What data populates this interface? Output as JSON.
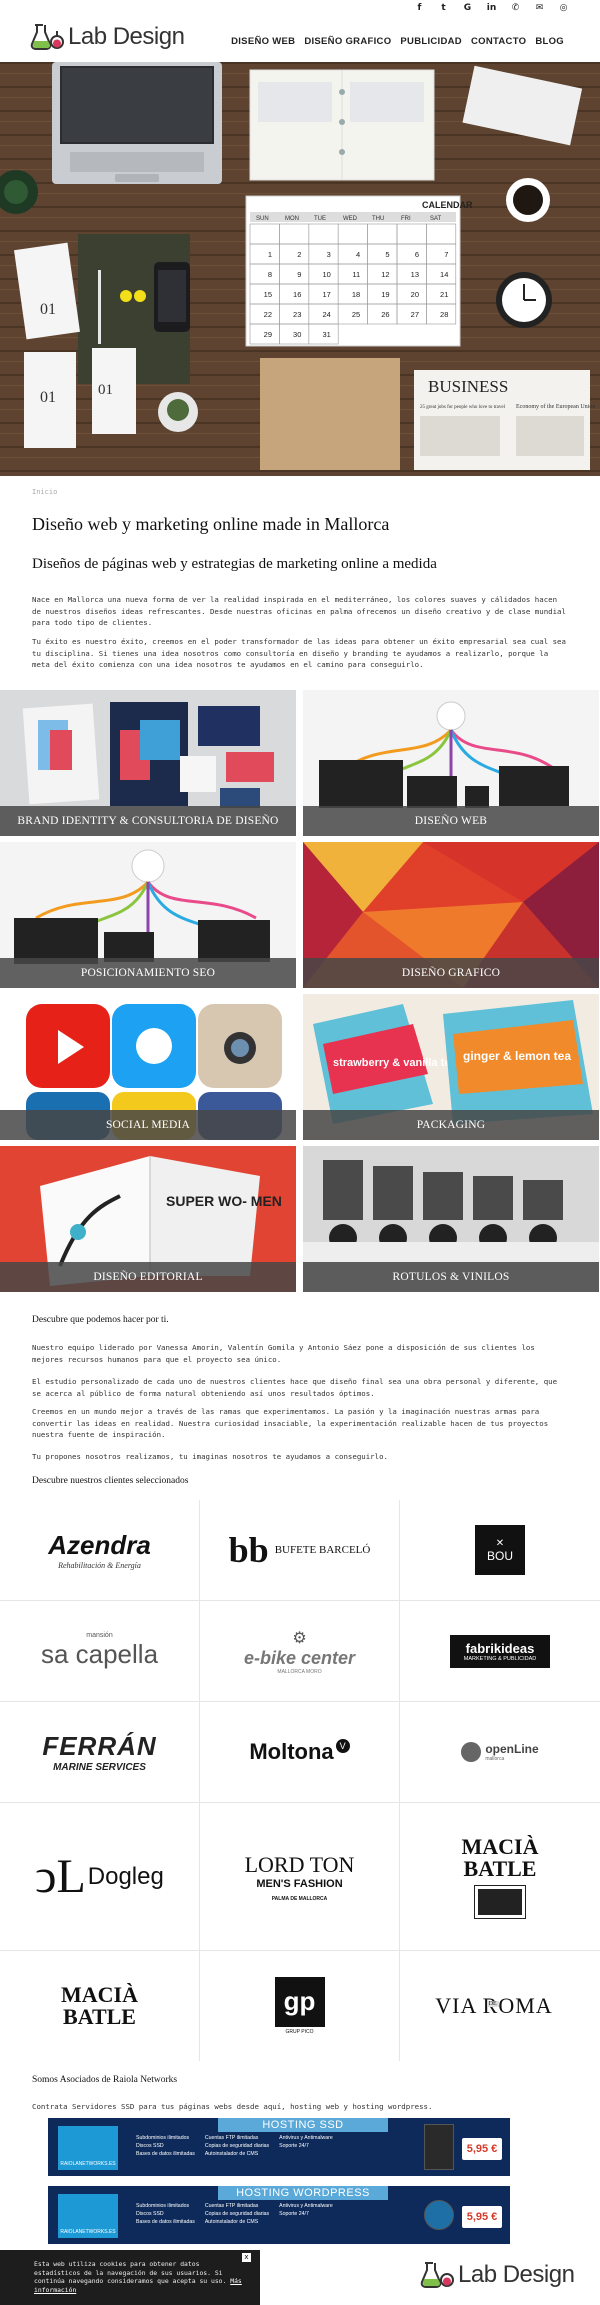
{
  "brand": {
    "name": "Lab Design"
  },
  "social": [
    {
      "icon": "facebook-icon",
      "glyph": "f"
    },
    {
      "icon": "twitter-icon",
      "glyph": "t"
    },
    {
      "icon": "google-icon",
      "glyph": "G"
    },
    {
      "icon": "linkedin-icon",
      "glyph": "in"
    },
    {
      "icon": "phone-icon",
      "glyph": "✆"
    },
    {
      "icon": "email-icon",
      "glyph": "✉"
    },
    {
      "icon": "instagram-icon",
      "glyph": "◎"
    }
  ],
  "nav": [
    "DISEÑO WEB",
    "DISEÑO GRAFICO",
    "PUBLICIDAD",
    "CONTACTO",
    "BLOG"
  ],
  "hero": {
    "calendar_title": "CALENDAR",
    "weekdays": [
      "SUN",
      "MON",
      "TUE",
      "WED",
      "THU",
      "FRI",
      "SAT"
    ],
    "days": [
      "",
      "",
      "",
      "",
      "",
      "",
      "",
      "1",
      "2",
      "3",
      "4",
      "5",
      "6",
      "7",
      "8",
      "9",
      "10",
      "11",
      "12",
      "13",
      "14",
      "15",
      "16",
      "17",
      "18",
      "19",
      "20",
      "21",
      "22",
      "23",
      "24",
      "25",
      "26",
      "27",
      "28",
      "29",
      "30",
      "31"
    ],
    "newspaper_title": "BUSINESS",
    "newspaper_headline1": "25 great jobs for people who love to travel",
    "newspaper_headline2": "Economy of the European Union",
    "notebook_nums": [
      "01",
      "01",
      "01"
    ]
  },
  "breadcrumb": "Inicio",
  "title": "Diseño web y marketing online made in Mallorca",
  "subtitle": "Diseños de páginas web y estrategias de marketing online a medida",
  "intro": [
    "Nace en Mallorca una nueva forma de ver la realidad inspirada en el mediterráneo, los colores suaves y cálidados hacen de nuestros diseños ideas refrescantes. Desde nuestras oficinas en palma ofrecemos un diseño creativo y de clase mundial para todo tipo de clientes.",
    "Tu éxito es nuestro éxito, creemos en el poder transformador de las ideas para obtener un éxito empresarial sea cual sea tu disciplina. Si tienes una idea nosotros como consultoría en diseño y branding te ayudamos a realizarlo, porque la meta del éxito comienza con una idea nosotros te ayudamos en el camino para conseguirlo."
  ],
  "services": [
    "BRAND IDENTITY & CONSULTORIA DE DISEÑO",
    "DISEÑO WEB",
    "POSICIONAMIENTO SEO",
    "DISEÑO GRAFICO",
    "SOCIAL MEDIA",
    "PACKAGING",
    "DISEÑO EDITORIAL",
    "ROTULOS & VINILOS"
  ],
  "packaging_text": [
    "strawberry & vanilla tea",
    "ginger & lemon tea"
  ],
  "editorial_text": "SUPER WO- MEN",
  "about": {
    "heading": "Descubre que podemos hacer por ti.",
    "paragraphs": [
      "Nuestro equipo liderado por Vanessa Amorin, Valentín Gomila y Antonio Sáez pone a disposición de sus clientes los mejores recursos humanos para que el proyecto sea único.",
      "El estudio personalizado de cada uno de nuestros clientes hace que diseño final sea una obra personal y diferente, que se acerca al público de forma natural obteniendo así unos resultados óptimos.",
      "Creemos en un mundo mejor a través de las ramas que experimentamos. La pasión y la imaginación nuestras armas para convertir las ideas en realidad. Nuestra curiosidad insaciable, la experimentación realizable hacen de tus proyectos nuestra fuente de inspiración.",
      "Tu propones nosotros realizamos, tu imaginas nosotros te ayudamos a conseguirlo."
    ]
  },
  "clients_heading": "Descubre nuestros clientes seleccionados",
  "clients": [
    {
      "name": "Azendra",
      "tag": "Rehabilitación & Energía"
    },
    {
      "name": "BUFETE BARCELÓ",
      "tag": ""
    },
    {
      "name": "BOU",
      "tag": ""
    },
    {
      "name": "sa capella",
      "tag": "mansión"
    },
    {
      "name": "e-bike center",
      "tag": "MALLORCA MORO"
    },
    {
      "name": "fabrikideas",
      "tag": "MARKETING & PUBLICIDAD"
    },
    {
      "name": "FERRÁN",
      "tag": "MARINE SERVICES"
    },
    {
      "name": "Moltona",
      "tag": "V"
    },
    {
      "name": "openLine",
      "tag": "mallorca"
    },
    {
      "name": "Dogleg",
      "tag": ""
    },
    {
      "name": "LORD TON",
      "tag": "MEN'S FASHION"
    },
    {
      "name": "MACIÀ BATLE",
      "tag": ""
    },
    {
      "name": "MACIÀ BATLE",
      "tag": ""
    },
    {
      "name": "gp",
      "tag": "GRUP PICO"
    },
    {
      "name": "VIA ROMA",
      "tag": "DE"
    }
  ],
  "lordton_sub": "PALMA DE MALLORCA",
  "partners": {
    "heading": "Somos Asociados de Raiola Networks",
    "text": "Contrata Servidores SSD para tus páginas webs desde aquí, hosting web y hosting wordpress."
  },
  "hosting": [
    {
      "title": "HOSTING SSD",
      "badge": "RAIOLANETWORKS.ES",
      "col1": [
        "Subdominios ilimitados",
        "Discos SSD",
        "Bases de datos ilimitadas"
      ],
      "col2": [
        "Cuentas FTP ilimitadas",
        "Copias de seguridad diarias",
        "Autoinstalador de CMS"
      ],
      "col3": [
        "Antivirus y Antimalware",
        "Soporte 24/7"
      ],
      "price": "5,95 €"
    },
    {
      "title": "HOSTING WORDPRESS",
      "badge": "RAIOLANETWORKS.ES",
      "col1": [
        "Subdominios ilimitados",
        "Discos SSD",
        "Bases de datos ilimitadas"
      ],
      "col2": [
        "Cuentas FTP ilimitadas",
        "Copias de seguridad diarias",
        "Autoinstalador de CMS"
      ],
      "col3": [
        "Antivirus y Antimalware",
        "Soporte 24/7"
      ],
      "price": "5,95 €"
    }
  ],
  "cookie": {
    "text": "Esta web utiliza cookies para obtener datos estadísticos de la navegación de sus usuarios. Si continúa navegando consideramos que acepta su uso.",
    "link": "Más información",
    "close": "x"
  },
  "colors": {
    "accent": "#7fc04a",
    "text": "#111111",
    "caption_bg": "#464646",
    "hosting_bg": "#0e2a5a"
  }
}
